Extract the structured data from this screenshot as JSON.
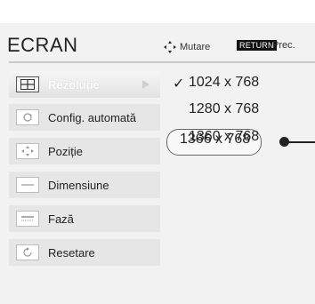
{
  "header": {
    "title": "ECRAN",
    "move_hint": "Mutare",
    "return_key": "RETURN",
    "return_hint": "Prec."
  },
  "menu": {
    "items": [
      {
        "label": "Rezoluție",
        "icon": "resolution-icon",
        "active": true
      },
      {
        "label": "Config. automată",
        "icon": "auto-config-icon",
        "active": false
      },
      {
        "label": "Poziție",
        "icon": "position-icon",
        "active": false
      },
      {
        "label": "Dimensiune",
        "icon": "size-icon",
        "active": false
      },
      {
        "label": "Fază",
        "icon": "phase-icon",
        "active": false
      },
      {
        "label": "Resetare",
        "icon": "reset-icon",
        "active": false
      }
    ]
  },
  "resolution_options": {
    "items": [
      "1024 x 768",
      "1280 x 768",
      "1360 x 768",
      "1366 x 768"
    ],
    "checked": "1024 x 768",
    "highlighted": "1366 x 768",
    "check_mark": "✓"
  }
}
